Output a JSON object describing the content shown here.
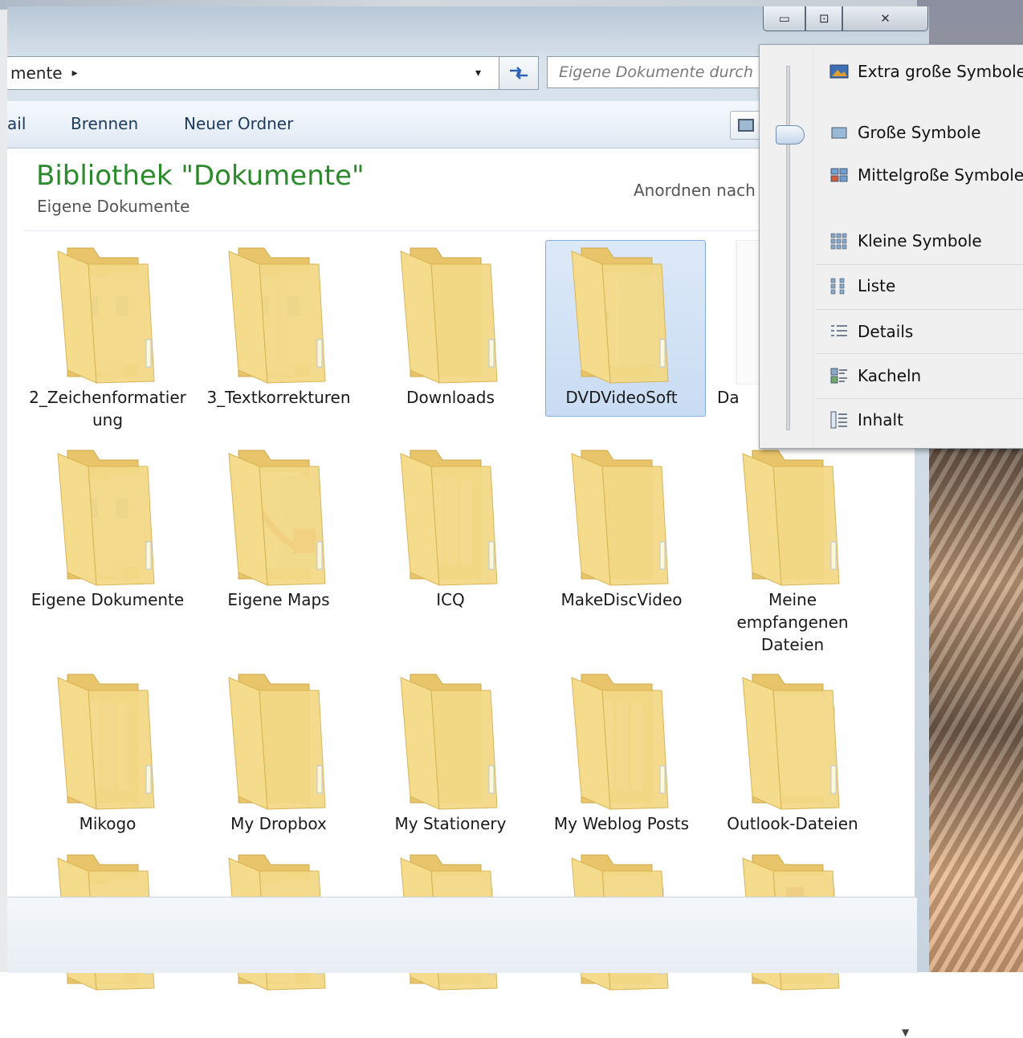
{
  "window": {
    "address": {
      "crumb": "mente",
      "separator": "▸",
      "dropdown": "▾"
    },
    "refresh_icon": "refresh-icon",
    "search": {
      "placeholder": "Eigene Dokumente durch"
    },
    "caption_buttons": {
      "minimize": "▭",
      "maximize": "⊡",
      "close": "✕"
    }
  },
  "toolbar": {
    "items": [
      {
        "label": "ail"
      },
      {
        "label": "Brennen"
      },
      {
        "label": "Neuer Ordner"
      }
    ]
  },
  "library": {
    "title": "Bibliothek \"Dokumente\"",
    "subtitle": "Eigene Dokumente",
    "arrange_label": "Anordnen nach"
  },
  "items": [
    {
      "label": "2_Zeichenformatierung",
      "style": "docs",
      "selected": false
    },
    {
      "label": "3_Textkorrekturen",
      "style": "docs",
      "selected": false
    },
    {
      "label": "Downloads",
      "style": "plain",
      "selected": false
    },
    {
      "label": "DVDVideoSoft",
      "style": "media",
      "selected": true
    },
    {
      "label": "Da",
      "style": "blank",
      "selected": false
    },
    {
      "label": "Eigene Dokumente",
      "style": "docs",
      "selected": false
    },
    {
      "label": "Eigene Maps",
      "style": "pdf",
      "selected": false
    },
    {
      "label": "ICQ",
      "style": "papers",
      "selected": false
    },
    {
      "label": "MakeDiscVideo",
      "style": "plain",
      "selected": false
    },
    {
      "label": "Meine empfangenen Dateien",
      "style": "plain",
      "selected": false
    },
    {
      "label": "Mikogo",
      "style": "papers",
      "selected": false
    },
    {
      "label": "My Dropbox",
      "style": "plain",
      "selected": false
    },
    {
      "label": "My Stationery",
      "style": "plain",
      "selected": false
    },
    {
      "label": "My Weblog Posts",
      "style": "papers",
      "selected": false
    },
    {
      "label": "Outlook-Dateien",
      "style": "whitedoc",
      "selected": false
    },
    {
      "label": "",
      "style": "docs",
      "selected": false
    },
    {
      "label": "",
      "style": "docs",
      "selected": false
    },
    {
      "label": "",
      "style": "whitedoc",
      "selected": false
    },
    {
      "label": "",
      "style": "whitedoc",
      "selected": false
    },
    {
      "label": "",
      "style": "reddoc",
      "selected": false
    }
  ],
  "view_menu": {
    "items": [
      {
        "label": "Extra große Symbole",
        "icon": "extra-large-icons-icon"
      },
      {
        "label": "Große Symbole",
        "icon": "large-icons-icon"
      },
      {
        "label": "Mittelgroße Symbole",
        "icon": "medium-icons-icon"
      },
      {
        "label": "Kleine Symbole",
        "icon": "small-icons-icon"
      },
      {
        "label": "Liste",
        "icon": "list-icon"
      },
      {
        "label": "Details",
        "icon": "details-icon"
      },
      {
        "label": "Kacheln",
        "icon": "tiles-icon"
      },
      {
        "label": "Inhalt",
        "icon": "content-icon"
      }
    ],
    "slider_level": "Große Symbole"
  },
  "colors": {
    "title_green": "#2b8a2b",
    "selection": "#c9dcf3",
    "folder": "#f3d987"
  }
}
